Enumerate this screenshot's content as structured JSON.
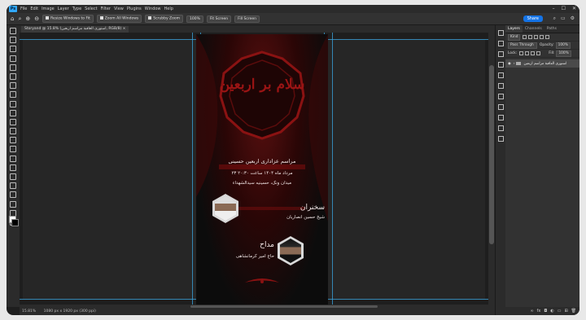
{
  "menu": {
    "logo": "Ps",
    "items": [
      "File",
      "Edit",
      "Image",
      "Layer",
      "Type",
      "Select",
      "Filter",
      "View",
      "Plugins",
      "Window",
      "Help"
    ],
    "window_controls": [
      "–",
      "☐",
      "✕"
    ]
  },
  "options_bar": {
    "resize_windows": "Resize Windows to Fit",
    "zoom_all": "Zoom All Windows",
    "scrubby_zoom": "Scrubby Zoom",
    "zoom_100": "100%",
    "fit_screen": "Fit Screen",
    "fill_screen": "Fill Screen",
    "share": "Share"
  },
  "document": {
    "tab_title": "Storyand @ 15.8% (استوری العاقبة مراسم اربعین, RGB/8) ×"
  },
  "poster": {
    "emblem_text": "سلام بر اربعین",
    "line1": "مراسم عزاداری اربعین حسینی",
    "line2": "۲۳ مرداد ماه ۱۴۰۴ ساعت ۲۰:۳۰",
    "line3": "میدان ونک، حسینیه سیدالشهداء",
    "speaker_title": "سخنران",
    "speaker_name": "شیخ حسین انصاریان",
    "eulogist_title": "مداح",
    "eulogist_name": "حاج امیر کرمانشاهی"
  },
  "status": {
    "zoom": "15.81%",
    "dimensions": "1080 px x 1920 px (300 ppi)"
  },
  "layers_panel": {
    "tabs": [
      "Layers",
      "Channels",
      "Paths"
    ],
    "kind": "Kind",
    "pass_through": "Pass Through",
    "opacity_label": "Opacity:",
    "opacity_value": "100%",
    "lock_label": "Lock:",
    "fill_label": "Fill:",
    "fill_value": "100%",
    "layer_name": "استوری العاقبة مراسم اربعین"
  },
  "colors": {
    "accent": "#1473e6",
    "poster_red": "#9a1414"
  }
}
